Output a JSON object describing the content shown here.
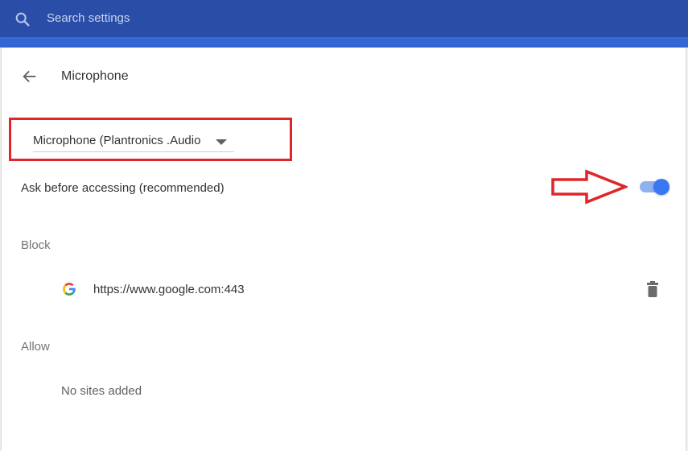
{
  "search": {
    "placeholder": "Search settings"
  },
  "page": {
    "title": "Microphone"
  },
  "device_select": {
    "value": "Microphone (Plantronics .Audio"
  },
  "ask_setting": {
    "label": "Ask before accessing (recommended)",
    "enabled": true
  },
  "block": {
    "heading": "Block",
    "sites": [
      {
        "url": "https://www.google.com:443",
        "icon": "google-icon"
      }
    ]
  },
  "allow": {
    "heading": "Allow",
    "empty_text": "No sites added"
  },
  "colors": {
    "header": "#2a4ea8",
    "accent": "#3a78f2",
    "annotation": "#e0262a"
  },
  "icons": {
    "search": "search-icon",
    "back": "back-arrow-icon",
    "delete": "trash-icon"
  }
}
